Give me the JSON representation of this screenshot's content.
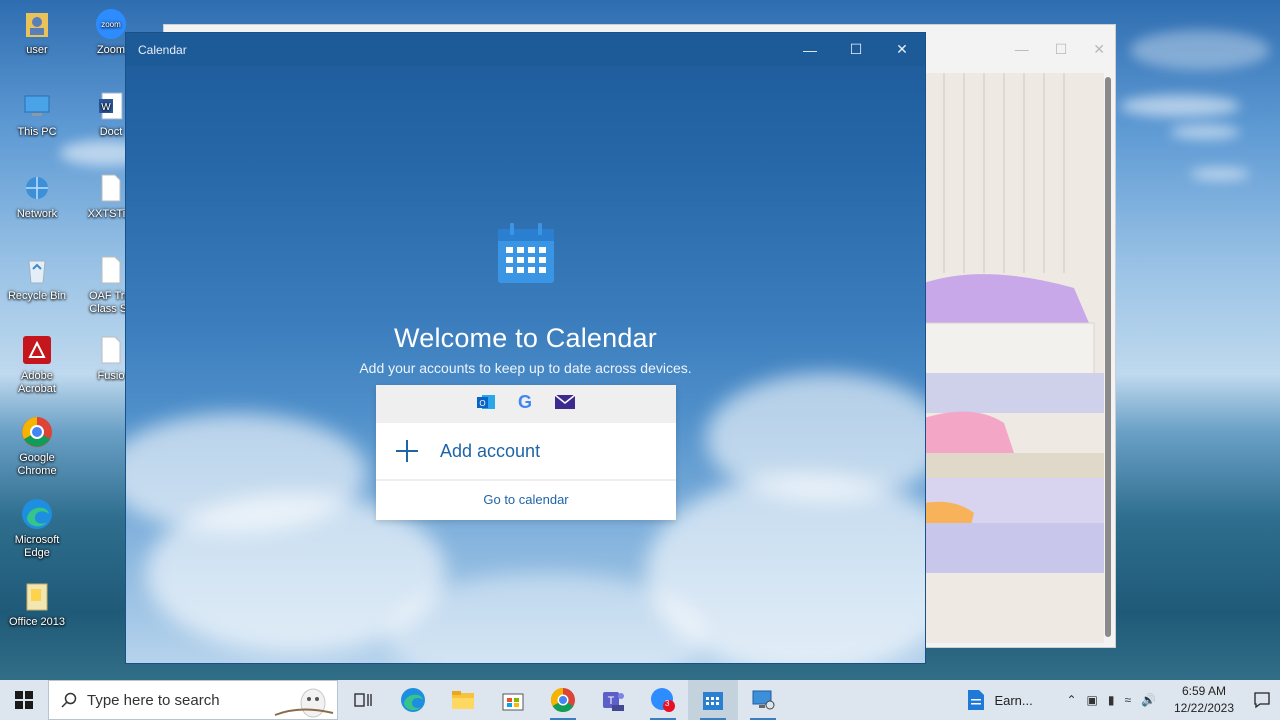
{
  "desktop": {
    "icons_col1": [
      {
        "label": "user",
        "icon": "user-folder-icon"
      },
      {
        "label": "This PC",
        "icon": "this-pc-icon"
      },
      {
        "label": "Network",
        "icon": "network-icon"
      },
      {
        "label": "Recycle Bin",
        "icon": "recycle-bin-icon"
      },
      {
        "label": "Adobe Acrobat",
        "icon": "adobe-acrobat-icon"
      },
      {
        "label": "Google Chrome",
        "icon": "chrome-icon"
      },
      {
        "label": "Microsoft Edge",
        "icon": "edge-icon"
      },
      {
        "label": "Office 2013",
        "icon": "folder-icon"
      }
    ],
    "icons_col2": [
      {
        "label": "Zoom",
        "icon": "zoom-icon"
      },
      {
        "label": "Doct",
        "icon": "word-doc-icon"
      },
      {
        "label": "XXTSTim",
        "icon": "file-icon"
      },
      {
        "label": "OAF Trai Class Sc",
        "icon": "file-icon"
      },
      {
        "label": "Fusio",
        "icon": "file-icon"
      }
    ]
  },
  "calendar_window": {
    "title": "Calendar",
    "welcome_title": "Welcome to Calendar",
    "subtitle": "Add your accounts to keep up to date across devices.",
    "providers": [
      "outlook-icon",
      "google-icon",
      "mail-icon"
    ],
    "add_account_label": "Add account",
    "go_to_calendar_label": "Go to calendar"
  },
  "taskbar": {
    "search_placeholder": "Type here to search",
    "apps": [
      "task-view-icon",
      "edge-icon",
      "file-explorer-icon",
      "store-icon",
      "chrome-icon",
      "teams-icon",
      "zoom-icon",
      "calendar-icon",
      "network-app-icon"
    ],
    "zoom_badge": "3",
    "pinned_label": "Earn...",
    "time": "6:59 AM",
    "date": "12/22/2023"
  },
  "colors": {
    "accent": "#1f64a8",
    "calendar_bg": "#1c5a98",
    "taskbar_bg": "#dde6ee"
  }
}
